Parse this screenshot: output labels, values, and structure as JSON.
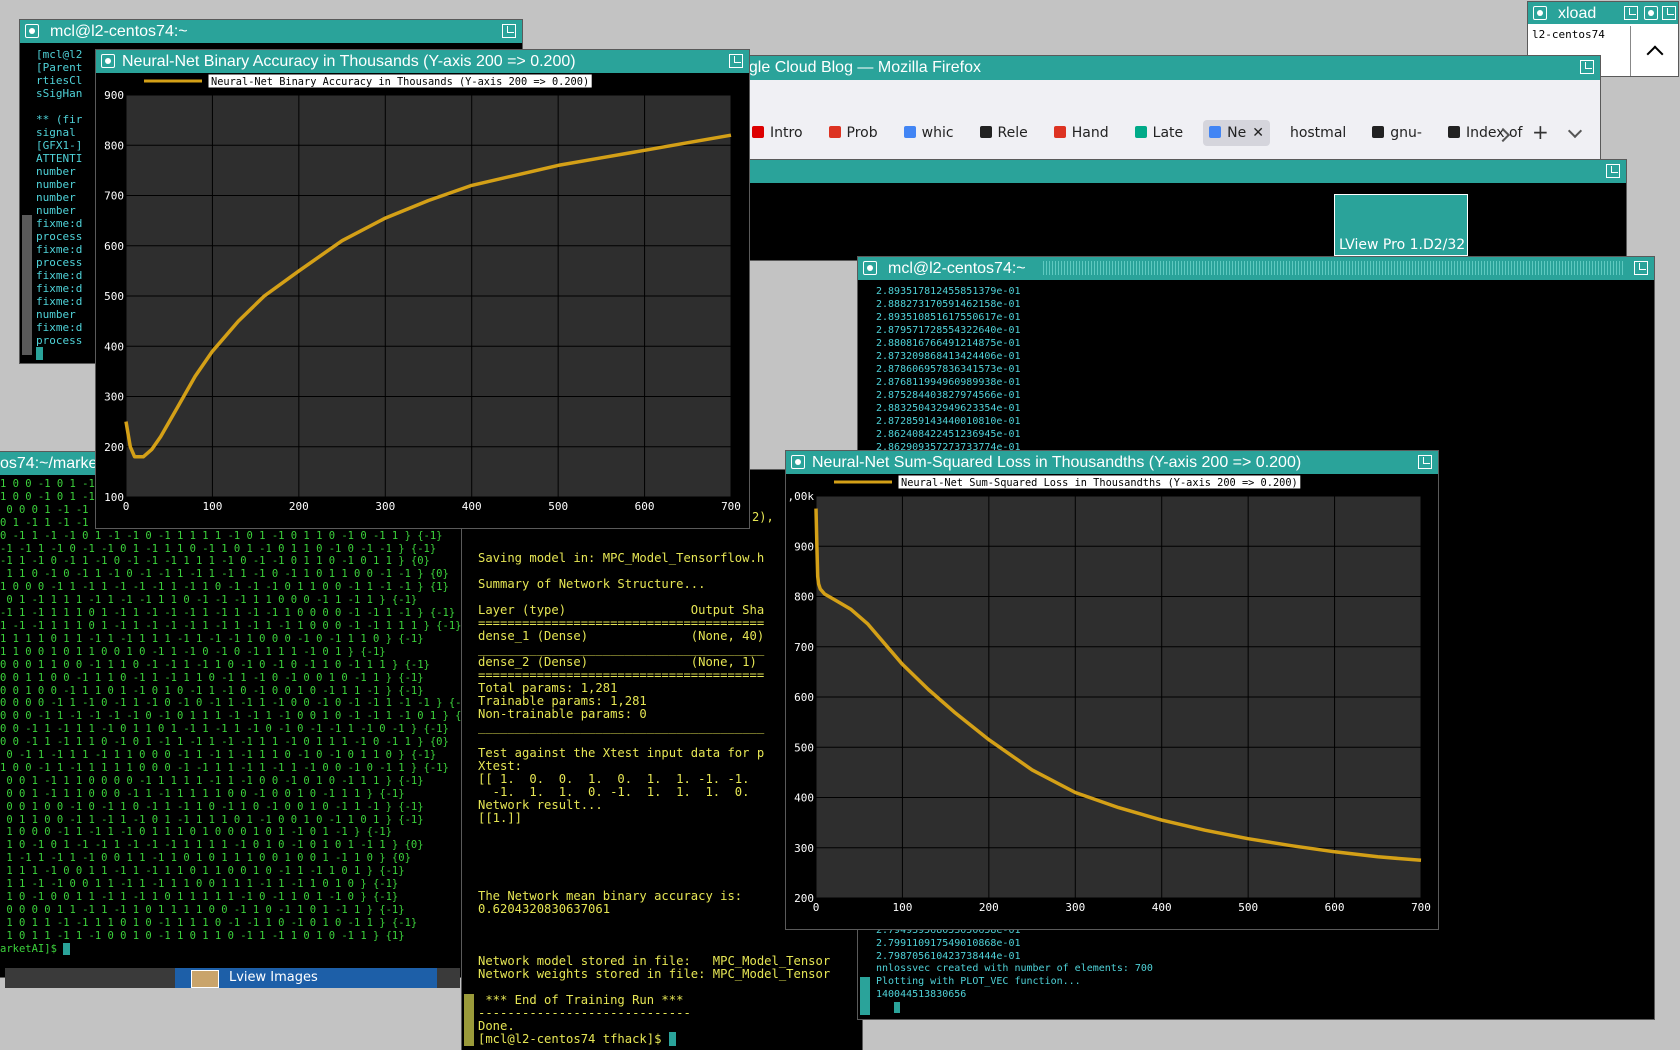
{
  "xload": {
    "title": "xload",
    "host": "l2-centos74"
  },
  "term_tl": {
    "title": "mcl@l2-centos74:~",
    "lines": [
      "[mcl@l2",
      "[Parent",
      "rtiesCl",
      "sSigHan",
      "",
      "** (fir",
      "signal ",
      "[GFX1-]",
      "ATTENTI",
      "number ",
      "number ",
      "number ",
      "number ",
      "fixme:d",
      "process",
      "fixme:d",
      "process",
      "fixme:d",
      "fixme:d",
      "fixme:d",
      "number ",
      "fixme:d",
      "process",
      "[]"
    ]
  },
  "term_left": {
    "title": "os74:~/marke",
    "lines": [
      "1 0 0 -1 0 1 -1 -",
      "1 0 0 -1 0 1 -1 -",
      " 0 0 0 1 -1 -1 -",
      "0 1 -1 1 -1 -1 ",
      "0 -1 1 -1 -1 0 1 -1 -1 0 -1 1 1 1 1 -1 0 1 -1 0 1 1 0 -1 0 -1 1 } {-1}",
      "-1 -1 1 -1 0 -1 -1 0 1 -1 1 1 0 -1 1 0 1 -1 0 1 1 0 -1 0 -1 -1 } {-1}",
      "-1 1 -1 0 -1 1 -1 0 -1 -1 -1 1 1 1 -1 0 -1 -1 0 1 1 0 -1 0 1 1 } {0}",
      " 1 1 0 -1 0 -1 1 -1 0 -1 -1 1 -1 1 -1 1 -1 0 -1 1 0 1 1 0 0 -1 -1 } {0}",
      "1 0 0 0 -1 1 -1 1 -1 -1 -1 1 -1 1 0 -1 -1 -1 0 1 1 0 0 -1 1 -1 -1 } {1}",
      " 0 1 -1 1 1 1 -1 1 -1 -1 1 1 0 -1 -1 -1 1 1 0 0 0 -1 1 -1 1 } {-1}",
      "-1 1 -1 1 1 1 0 1 -1 1 -1 -1 -1 1 -1 1 -1 -1 1 0 0 0 0 -1 -1 1 -1 } {-1}",
      "1 -1 -1 1 1 1 0 1 -1 1 -1 -1 -1 1 -1 1 -1 1 -1 1 0 0 0 -1 -1 1 1 1 } {-1}",
      "1 1 1 1 0 1 1 -1 1 -1 1 1 1 -1 1 -1 -1 1 0 0 0 -1 0 -1 1 1 0 } {-1}",
      "1 1 0 0 1 0 1 1 0 0 1 0 -1 1 -1 0 -1 0 -1 1 1 1 -1 0 1 } {-1}",
      "0 0 0 1 1 0 0 -1 1 1 0 -1 -1 1 -1 1 0 -1 0 -1 0 -1 1 0 -1 1 1 } {-1}",
      "0 0 1 1 0 0 -1 1 1 0 -1 1 -1 1 1 0 -1 1 -1 0 -1 0 0 1 0 -1 1 } {-1}",
      "0 0 1 0 0 -1 1 1 0 1 -1 0 1 0 -1 1 -1 0 -1 0 0 1 0 -1 1 1 -1 } {-1}",
      "0 0 0 0 -1 1 -1 0 -1 1 -1 0 -1 0 -1 1 -1 1 -1 0 0 -1 0 -1 -1 1 -1 -1 } {-1}",
      "0 0 0 -1 1 -1 -1 -1 -1 0 -1 0 1 1 1 -1 -1 1 -1 0 0 1 0 -1 -1 1 -1 0 1 } {-1}",
      "0 0 -1 1 -1 1 1 -1 0 1 1 0 1 -1 1 -1 1 -1 0 -1 0 -1 -1 1 -1 0 -1 } {-1}",
      "0 0 -1 1 -1 1 1 0 -1 0 1 -1 1 -1 1 -1 -1 1 1 -1 0 1 1 1 -1 0 -1 1 } {0}",
      " 0 -1 1 -1 1 1 -1 1 1 0 0 0 -1 1 -1 1 -1 1 1 0 -1 0 -1 0 1 1 0 } {-1}",
      "1 0 0 -1 1 -1 1 1 1 1 0 0 0 -1 -1 1 1 -1 1 -1 1 -1 0 0 -1 0 -1 1 } {-1}",
      " 0 0 1 -1 1 1 0 0 0 0 -1 1 1 1 1 -1 1 -1 0 0 -1 0 1 0 -1 1 1 } {-1}",
      " 0 0 1 -1 1 1 0 0 0 -1 1 -1 1 1 1 1 0 0 -1 0 0 1 0 -1 1 1 } {-1}",
      " 0 0 1 0 0 -1 0 -1 1 0 -1 1 -1 1 0 -1 1 0 -1 0 0 1 0 -1 1 -1 } {-1}",
      " 0 1 1 0 0 -1 1 -1 1 -1 0 1 -1 1 1 1 0 1 -1 0 0 1 0 -1 1 0 1 } {-1}",
      " 1 0 0 0 -1 1 -1 1 -1 0 1 1 1 0 1 0 0 0 1 0 1 -1 0 1 -1 } {-1}",
      " 1 0 -1 0 1 -1 -1 1 -1 -1 -1 1 1 1 1 -1 0 1 0 -1 0 1 0 1 -1 1 } {0}",
      " 1 -1 1 -1 1 -1 0 0 1 1 -1 1 0 1 0 1 1 1 0 0 1 0 0 1 -1 1 0 } {0}",
      " 1 1 1 -1 0 0 1 1 -1 1 -1 1 1 0 1 1 0 0 1 0 -1 1 -1 1 0 1 } {-1}",
      " 1 1 -1 -1 0 0 1 1 -1 1 -1 1 1 0 0 1 1 1 -1 1 -1 1 0 1 0 } {-1}",
      " 1 0 -1 0 0 1 1 -1 1 -1 1 0 1 1 1 1 1 -1 0 -1 1 0 1 -1 0 } {-1}",
      " 0 0 0 0 1 1 -1 1 -1 1 0 1 1 1 1 0 0 -1 1 0 -1 1 0 1 -1 1 } {-1}",
      " 1 0 1 1 -1 -1 1 1 0 1 0 -1 1 1 1 0 -1 -1 1 0 -1 0 1 0 -1 1 } {-1}",
      " 1 0 1 1 -1 1 -1 0 0 1 0 -1 1 0 1 1 0 -1 1 -1 1 0 1 0 -1 1 } {1}",
      "arketAI]$ []"
    ]
  },
  "taskbar": {
    "label": "Lview Images"
  },
  "term_center": {
    "lines": [
      "Saving model in: MPC_Model_Tensorflow.h",
      "",
      "Summary of Network Structure...",
      "",
      "Layer (type)                 Output Sha",
      "=======================================",
      "dense_1 (Dense)              (None, 40)",
      "_______________________________________",
      "dense_2 (Dense)              (None, 1)",
      "=======================================",
      "Total params: 1,281",
      "Trainable params: 1,281",
      "Non-trainable params: 0",
      "_______________________________________",
      "",
      "Test against the Xtest input data for p",
      "Xtest:",
      "[[ 1.  0.  0.  1.  0.  1.  1. -1. -1.",
      "  -1.  1.  1.  0. -1.  1.  1.  1.  0.",
      "Network result...",
      "[[1.]]",
      "",
      "",
      "",
      "",
      "",
      "The Network mean binary accuracy is:",
      "0.6204320830637061",
      "",
      "",
      "",
      "Network model stored in file:   MPC_Model_Tensor",
      "Network weights stored in file: MPC_Model_Tensor",
      "",
      " *** End of Training Run ***",
      "-----------------------------",
      "Done.",
      "[mcl@l2-centos74 tfhack]$ []"
    ],
    "fragment": "2), "
  },
  "firefox": {
    "title": "ogle Cloud Blog — Mozilla Firefox",
    "tabs": [
      "Intro",
      "Prob",
      "whic",
      "Rele",
      "Hand",
      "Late",
      "Ne",
      "hostmal",
      "gnu-",
      "Index of"
    ]
  },
  "lview": {
    "label": "LView Pro 1.D2/32"
  },
  "term_right": {
    "title": "mcl@l2-centos74:~",
    "top_lines": [
      "2.893517812455851379e-01",
      "2.888273170591462158e-01",
      "2.893510851617550617e-01",
      "2.879571728554322640e-01",
      "2.880816766491214875e-01",
      "2.873209868413424406e-01",
      "2.878606957836341573e-01",
      "2.876811994960989938e-01",
      "2.875284403827974566e-01",
      "2.883250432949623354e-01",
      "2.872859143440010810e-01",
      "2.862408422451236945e-01",
      "2.862909357273733774e-01"
    ],
    "bottom_lines": [
      "2.794939568053050658e-01",
      "2.799110917549010868e-01",
      "2.798705610423738444e-01",
      "nnlossvec created with number of elements: 700",
      "Plotting with PLOT_VEC function...",
      "140044513830656",
      "   []"
    ]
  },
  "acc_plot": {
    "title": "Neural-Net Binary Accuracy in Thousands (Y-axis 200 => 0.200)",
    "legend": "Neural-Net Binary Accuracy in Thousands (Y-axis 200 => 0.200)",
    "line_color": "#d4a017"
  },
  "loss_plot": {
    "title": "Neural-Net Sum-Squared Loss in Thousandths (Y-axis 200 => 0.200)",
    "legend": "Neural-Net Sum-Squared Loss in Thousandths (Y-axis 200 => 0.200)",
    "line_color": "#d4a017"
  },
  "chart_data": [
    {
      "type": "line",
      "title": "Neural-Net Binary Accuracy in Thousands (Y-axis 200 => 0.200)",
      "series": [
        {
          "name": "Neural-Net Binary Accuracy in Thousands (Y-axis 200 => 0.200)",
          "x": [
            0,
            5,
            10,
            20,
            30,
            40,
            60,
            80,
            100,
            130,
            160,
            200,
            250,
            300,
            350,
            400,
            450,
            500,
            550,
            600,
            650,
            700
          ],
          "y": [
            250,
            200,
            180,
            180,
            195,
            220,
            280,
            340,
            390,
            450,
            500,
            550,
            610,
            655,
            690,
            720,
            740,
            760,
            775,
            790,
            805,
            820
          ]
        }
      ],
      "xlim": [
        0,
        700
      ],
      "ylim": [
        100,
        900
      ],
      "xticks": [
        0,
        100,
        200,
        300,
        400,
        500,
        600,
        700
      ],
      "yticks": [
        100,
        200,
        300,
        400,
        500,
        600,
        700,
        800,
        900
      ],
      "xlabel": "",
      "ylabel": "",
      "grid": true,
      "legend": "top-left"
    },
    {
      "type": "line",
      "title": "Neural-Net Sum-Squared Loss in Thousandths (Y-axis 200 => 0.200)",
      "series": [
        {
          "name": "Neural-Net Sum-Squared Loss in Thousandths (Y-axis 200 => 0.200)",
          "x": [
            0,
            1,
            2,
            3,
            5,
            10,
            20,
            40,
            60,
            80,
            100,
            130,
            160,
            200,
            250,
            300,
            350,
            400,
            450,
            500,
            550,
            600,
            650,
            700
          ],
          "y": [
            975,
            900,
            840,
            825,
            815,
            805,
            795,
            775,
            745,
            705,
            665,
            615,
            570,
            515,
            455,
            410,
            380,
            355,
            335,
            318,
            304,
            292,
            282,
            275
          ]
        }
      ],
      "xlim": [
        0,
        700
      ],
      "ylim": [
        200,
        1000
      ],
      "xticks": [
        0,
        100,
        200,
        300,
        400,
        500,
        600,
        700
      ],
      "yticks": [
        200,
        300,
        400,
        500,
        600,
        700,
        800,
        900,
        1000
      ],
      "ytick_labels": [
        "200",
        "300",
        "400",
        "500",
        "600",
        "700",
        "800",
        "900",
        ",00k"
      ],
      "xlabel": "",
      "ylabel": "",
      "grid": true,
      "legend": "top-left"
    }
  ]
}
